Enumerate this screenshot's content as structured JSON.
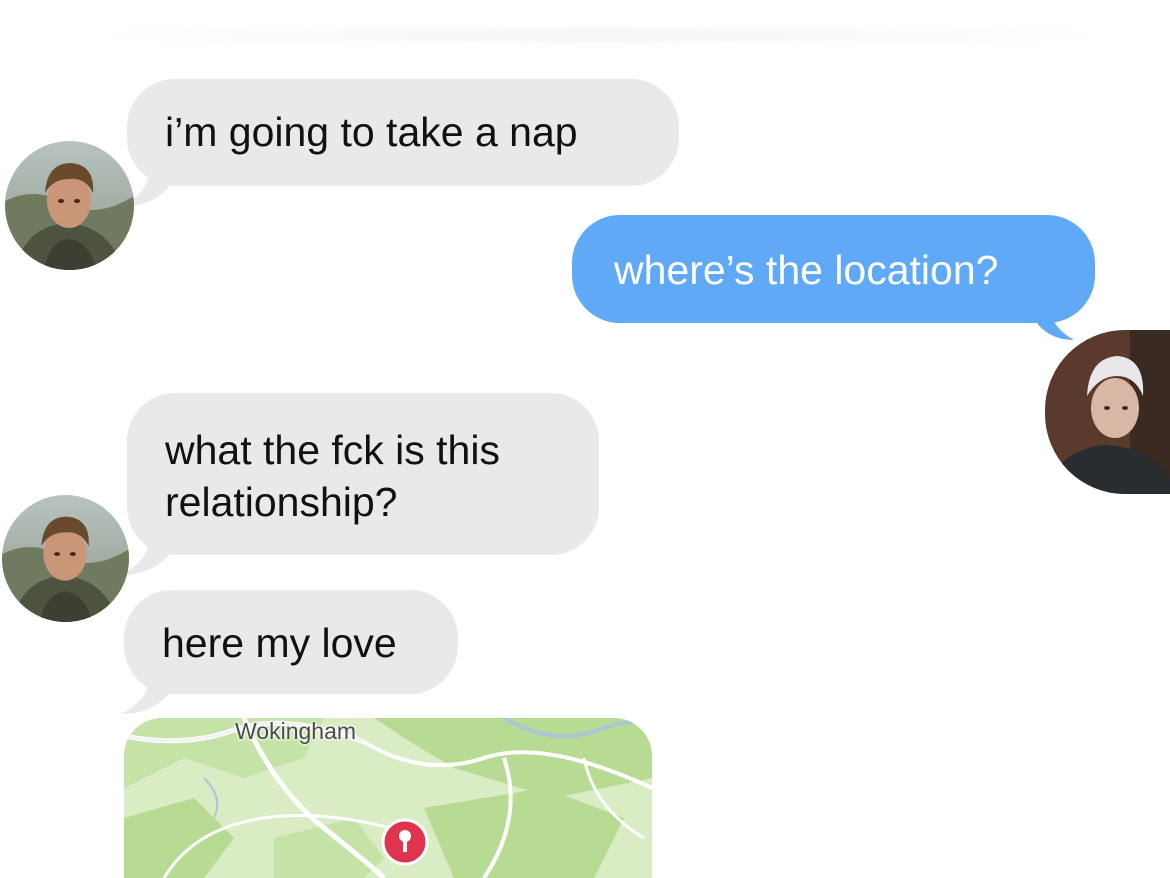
{
  "messages": [
    {
      "id": "m1",
      "direction": "incoming",
      "text": "i’m going to take a nap"
    },
    {
      "id": "m2",
      "direction": "outgoing",
      "text": "where’s the location?"
    },
    {
      "id": "m3",
      "direction": "incoming",
      "line1": "what the fck is this",
      "line2": "relationship?"
    },
    {
      "id": "m4",
      "direction": "incoming",
      "text": "here my love"
    }
  ],
  "map": {
    "place_label": "Wokingham",
    "pin_color": "#e0334e",
    "land_color": "#cfe6b4",
    "park_color": "#b7db92"
  },
  "colors": {
    "incoming_bubble": "#e9e9eb",
    "outgoing_bubble": "#5fa9f6"
  }
}
